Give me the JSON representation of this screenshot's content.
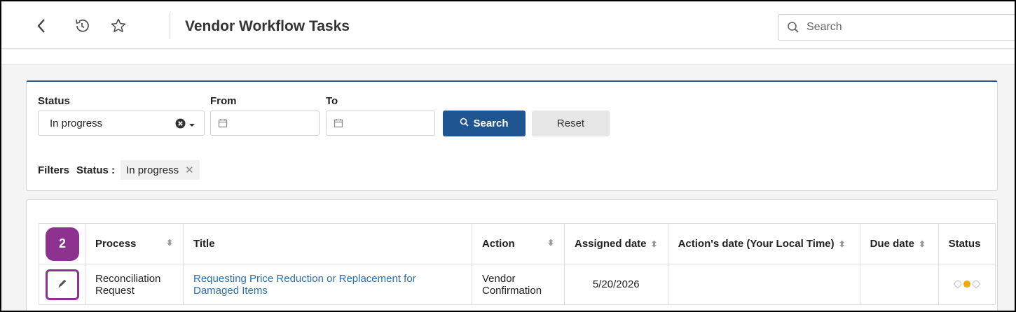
{
  "header": {
    "title": "Vendor Workflow Tasks",
    "search_placeholder": "Search"
  },
  "icons": {
    "back": "chevron-left-icon",
    "history": "history-icon",
    "favorite": "star-outline-icon"
  },
  "filters": {
    "status_label": "Status",
    "status_value": "In progress",
    "from_label": "From",
    "to_label": "To",
    "search_button": "Search",
    "reset_button": "Reset",
    "applied_label": "Filters",
    "applied": [
      {
        "key": "Status :",
        "value": "In progress"
      }
    ]
  },
  "table": {
    "badge": "2",
    "columns": [
      "Process",
      "Title",
      "Action",
      "Assigned date",
      "Action's date (Your Local Time)",
      "Due date",
      "Status"
    ],
    "rows": [
      {
        "process_line1": "Reconciliation",
        "process_line2": "Request",
        "title_line1": "Requesting Price Reduction or Replacement for",
        "title_line2": "Damaged Items",
        "action_line1": "Vendor",
        "action_line2": "Confirmation",
        "assigned_date": "5/20/2026",
        "actions_date": "",
        "due_date": "",
        "status_steps": [
          false,
          true,
          false
        ]
      }
    ]
  },
  "colors": {
    "primary": "#1f5591",
    "accent_badge": "#8e3290",
    "link": "#2a6fb0",
    "status_active": "#f5a700"
  }
}
